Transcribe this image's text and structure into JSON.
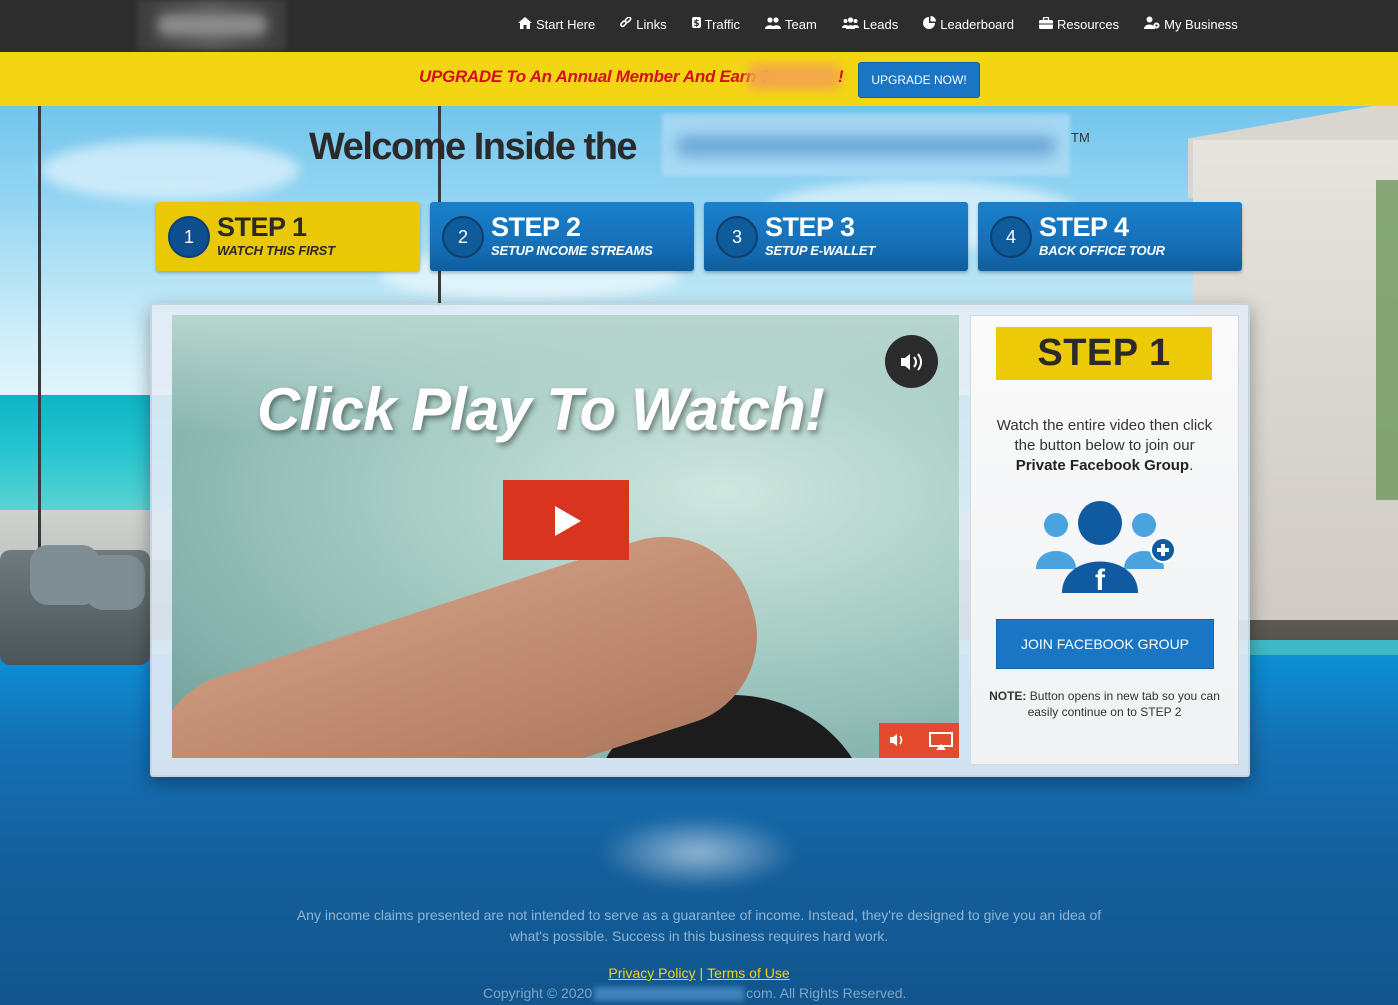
{
  "nav": {
    "items": [
      {
        "label": "Start Here",
        "icon": "home-icon"
      },
      {
        "label": "Links",
        "icon": "link-icon"
      },
      {
        "label": "Traffic",
        "icon": "dollar-icon"
      },
      {
        "label": "Team",
        "icon": "users-icon"
      },
      {
        "label": "Leads",
        "icon": "group-icon"
      },
      {
        "label": "Leaderboard",
        "icon": "chart-pie-icon"
      },
      {
        "label": "Resources",
        "icon": "briefcase-icon"
      },
      {
        "label": "My Business",
        "icon": "user-cog-icon"
      }
    ]
  },
  "promo": {
    "text": "UPGRADE To An Annual Member And Earn $",
    "exclamation": "!",
    "button_label": "UPGRADE NOW!",
    "text_color": "#d4101e",
    "bar_color": "#f4d514"
  },
  "headline": {
    "text": "Welcome Inside the",
    "trademark": "TM"
  },
  "steps": [
    {
      "number": "1",
      "title": "STEP 1",
      "subtitle": "WATCH THIS FIRST",
      "active": true
    },
    {
      "number": "2",
      "title": "STEP 2",
      "subtitle": "SETUP INCOME STREAMS",
      "active": false
    },
    {
      "number": "3",
      "title": "STEP 3",
      "subtitle": "SETUP E-WALLET",
      "active": false
    },
    {
      "number": "4",
      "title": "STEP 4",
      "subtitle": "BACK OFFICE TOUR",
      "active": false
    }
  ],
  "video": {
    "overlay_text": "Click Play To Watch!",
    "play_icon": "play-icon",
    "unmute_icon": "volume-icon",
    "controls": [
      "volume-icon",
      "airplay-icon"
    ],
    "accent_color": "#d9341f"
  },
  "sidebar": {
    "badge": "STEP 1",
    "text_prefix": "Watch the entire video then click the button below to join our ",
    "text_bold": "Private Facebook Group",
    "text_suffix": ".",
    "icon": "facebook-group-add-icon",
    "button_label": "JOIN FACEBOOK GROUP",
    "note_label": "NOTE:",
    "note_text": " Button opens in new tab so you can easily continue on to STEP 2"
  },
  "footer": {
    "disclaimer": "Any income claims presented are not intended to serve as a guarantee of income. Instead, they're designed to give you an idea of what's possible. Success in this business requires hard work.",
    "privacy_label": "Privacy Policy",
    "separator": "|",
    "terms_label": "Terms of Use",
    "copyright_prefix": "Copyright © 2020",
    "copyright_suffix": "com. All Rights Reserved."
  }
}
